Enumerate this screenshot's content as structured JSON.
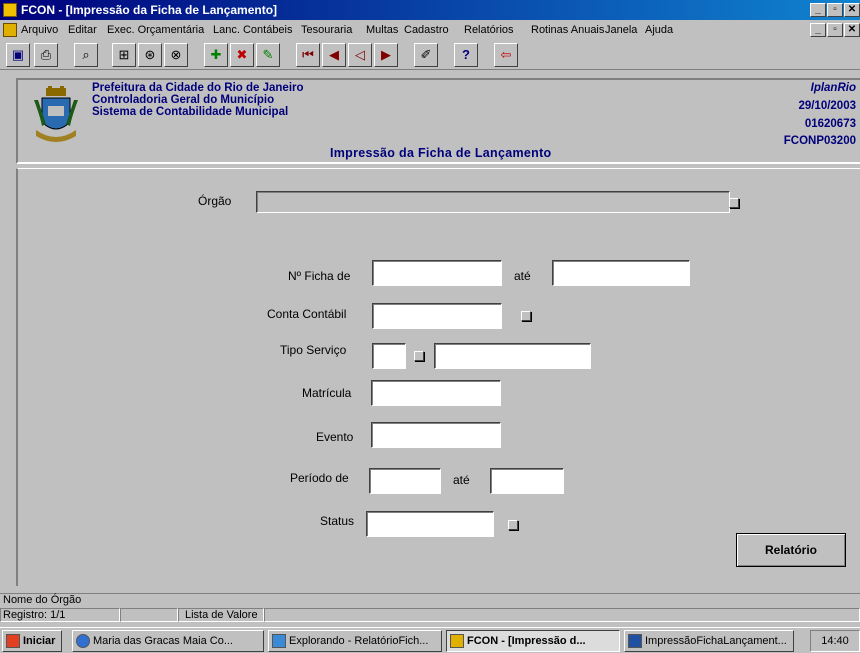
{
  "window": {
    "title": "FCON - [Impressão da Ficha de Lançamento]",
    "controls": [
      "_",
      "▫",
      "✕"
    ]
  },
  "menu": {
    "items": [
      "Arquivo",
      "Editar",
      "Exec. Orçamentária",
      "Lanc. Contábeis",
      "Tesouraria",
      "Multas",
      "Cadastro",
      "Relatórios",
      "Rotinas Anuais",
      "Janela",
      "Ajuda"
    ]
  },
  "header": {
    "org_line1": "Prefeitura da Cidade do Rio de Janeiro",
    "org_line2": "Controladoria Geral do Município",
    "org_line3": "Sistema de Contabilidade Municipal",
    "company": "IplanRio",
    "date": "29/10/2003",
    "code": "01620673",
    "form_id": "FCONP03200",
    "form_title": "Impressão  da Ficha de Lançamento"
  },
  "form": {
    "orgao_label": "Órgão",
    "ficha_label": "Nº Ficha de",
    "ate_label": "até",
    "conta_label": "Conta Contábil",
    "tipo_label": "Tipo Serviço",
    "matricula_label": "Matrícula",
    "evento_label": "Evento",
    "periodo_label": "Período de",
    "status_label": "Status",
    "orgao_value": "",
    "ficha_de_value": "",
    "ficha_ate_value": "",
    "conta_value": "",
    "tipo_code_value": "",
    "tipo_desc_value": "",
    "matricula_value": "",
    "evento_value": "",
    "periodo_de_value": "",
    "periodo_ate_value": "",
    "status_value": "",
    "relatorio_button": "Relatório"
  },
  "status": {
    "hint": "Nome do Órgão",
    "record": "Registro: 1/1",
    "lov": "Lista de Valore"
  },
  "taskbar": {
    "start": "Iniciar",
    "items": [
      "Maria das Gracas Maia Co...",
      "Explorando - RelatórioFich...",
      "FCON - [Impressão d...",
      "ImpressãoFichaLançament..."
    ],
    "clock": "14:40"
  },
  "colors": {
    "title_bar": "#00007b",
    "header_text": "#00007b",
    "face": "#c0c0c0"
  }
}
